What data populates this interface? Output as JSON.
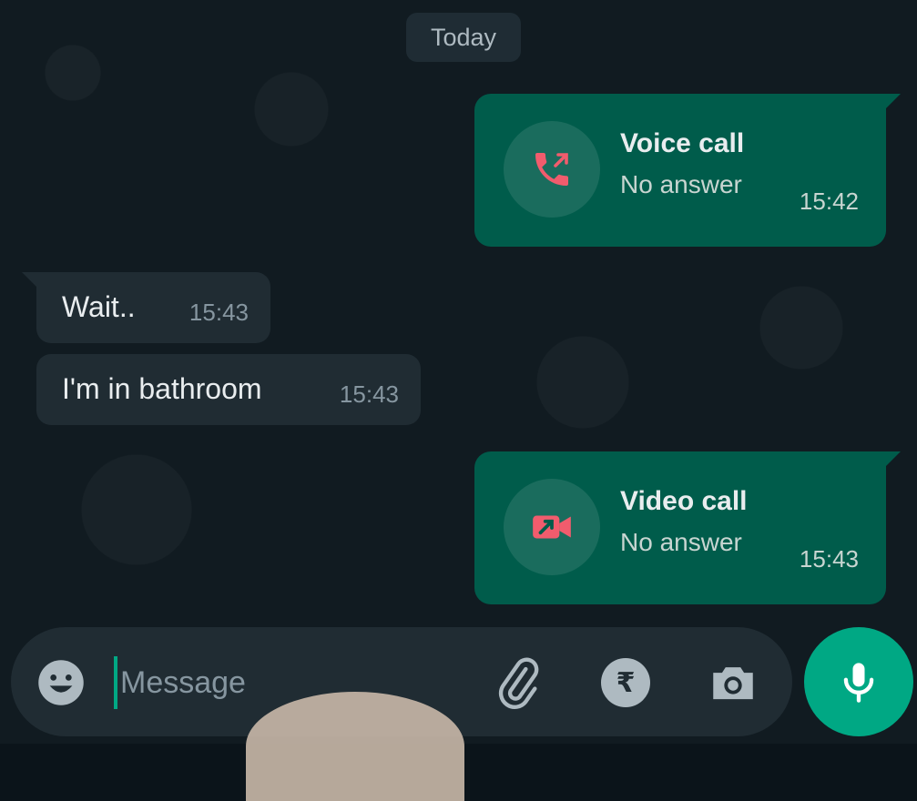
{
  "date_chip": "Today",
  "messages": [
    {
      "type": "call",
      "direction": "outgoing",
      "title": "Voice call",
      "status": "No answer",
      "time": "15:42",
      "icon": "outgoing-voice-call-icon",
      "icon_color": "#f15c6d"
    },
    {
      "type": "text",
      "direction": "incoming",
      "text": "Wait..",
      "time": "15:43"
    },
    {
      "type": "text",
      "direction": "incoming",
      "text": "I'm in bathroom",
      "time": "15:43"
    },
    {
      "type": "call",
      "direction": "outgoing",
      "title": "Video call",
      "status": "No answer",
      "time": "15:43",
      "icon": "outgoing-video-call-icon",
      "icon_color": "#f15c6d"
    }
  ],
  "composer": {
    "placeholder": "Message",
    "emoji_icon": "smiley-icon",
    "attach_icon": "paperclip-icon",
    "payment_icon": "rupee-icon",
    "payment_symbol": "₹",
    "camera_icon": "camera-icon"
  },
  "mic_button": {
    "icon": "microphone-icon"
  },
  "colors": {
    "outgoing_bubble": "#005c4b",
    "incoming_bubble": "#202c33",
    "accent": "#00a884",
    "background": "#111b21"
  }
}
